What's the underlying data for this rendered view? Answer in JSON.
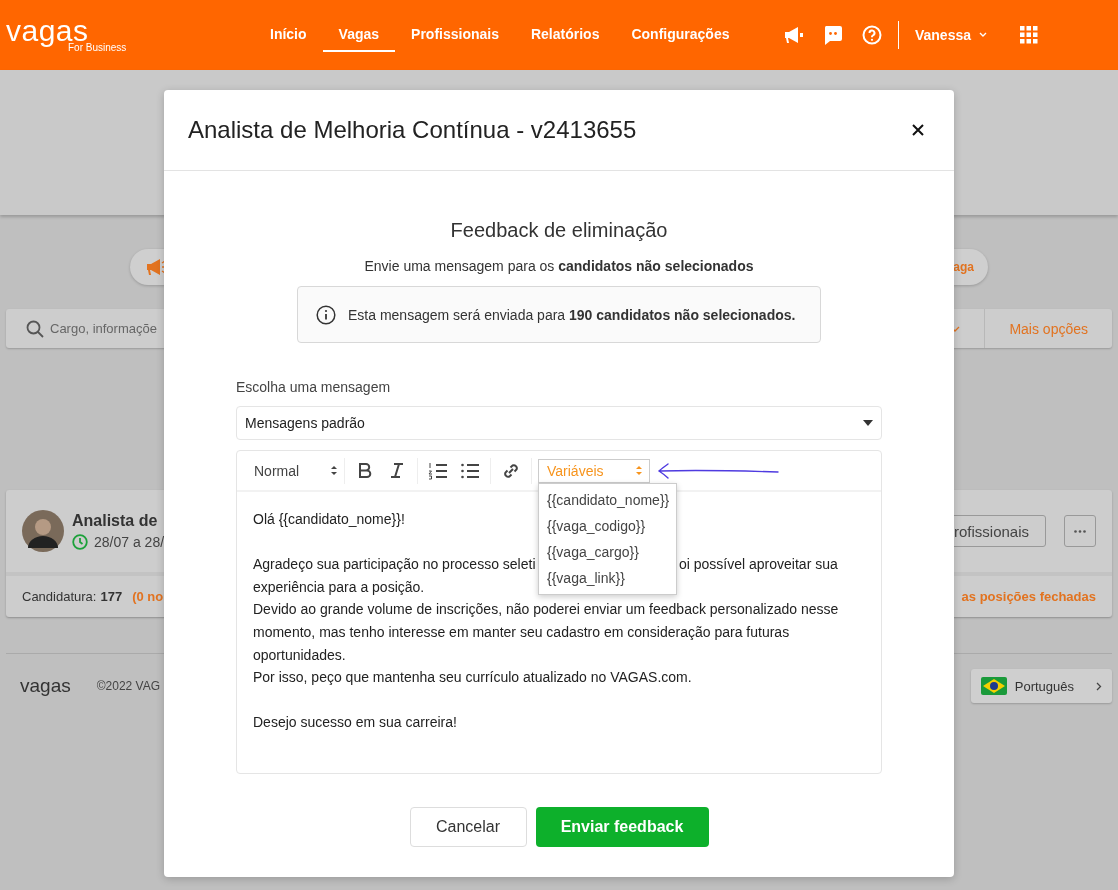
{
  "header": {
    "logo": "vagas",
    "logo_sub": "For Business",
    "nav": [
      {
        "label": "Início",
        "selected": false
      },
      {
        "label": "Vagas",
        "selected": true
      },
      {
        "label": "Profissionais",
        "selected": false
      },
      {
        "label": "Relatórios",
        "selected": false
      },
      {
        "label": "Configurações",
        "selected": false
      }
    ],
    "user": "Vanessa"
  },
  "background": {
    "pill_text": "aga",
    "search_placeholder": "Cargo, informaçõe",
    "more_options": "Mais opções",
    "job": {
      "title": "Analista de",
      "dates": "28/07 a 28/",
      "button": "rofissionais",
      "applications_label": "Candidatura:",
      "applications_count": "177",
      "applications_note": "(0 no",
      "closed_link": "as posições fechadas"
    },
    "footer": {
      "logo": "vagas",
      "copyright": "©2022 VAG",
      "language": "Português"
    }
  },
  "modal": {
    "title": "Analista de Melhoria Contínua - v2413655",
    "heading": "Feedback de eliminação",
    "subheading": "Envie uma mensagem para os **candidatos não selecionados**",
    "info": "Esta mensagem será enviada para **190 candidatos não selecionados.**",
    "select_label": "Escolha uma mensagem",
    "select_value": "Mensagens padrão",
    "editor": {
      "format": "Normal",
      "variables": {
        "label": "Variáveis",
        "expanded": true,
        "options": [
          "{{candidato_nome}}",
          "{{vaga_codigo}}",
          "{{vaga_cargo}}",
          "{{vaga_link}}"
        ]
      },
      "paragraphs": [
        {
          "lines": [
            {
              "kind": "text",
              "text": "Olá {{candidato_nome}}!"
            }
          ]
        },
        {
          "lines": [
            {
              "kind": "covered",
              "parts": [
                "Agradeço sua participação no processo seleti",
                "oi possível aproveitar sua"
              ]
            },
            {
              "kind": "text",
              "text": "experiência para a posição."
            },
            {
              "kind": "text",
              "text": "Devido ao grande volume de inscrições, não poderei enviar um feedback personalizado nesse"
            },
            {
              "kind": "text",
              "text": "momento, mas tenho interesse em manter seu cadastro em consideração para futuras"
            },
            {
              "kind": "text",
              "text": "oportunidades."
            },
            {
              "kind": "text",
              "text": "Por isso, peço que mantenha seu currículo atualizado no VAGAS.com."
            }
          ]
        },
        {
          "lines": [
            {
              "kind": "text",
              "text": "Desejo sucesso em sua carreira!"
            }
          ]
        }
      ]
    },
    "buttons": [
      {
        "kind": "secondary",
        "label": "Cancelar"
      },
      {
        "kind": "primary",
        "label": "Enviar feedback"
      }
    ]
  }
}
